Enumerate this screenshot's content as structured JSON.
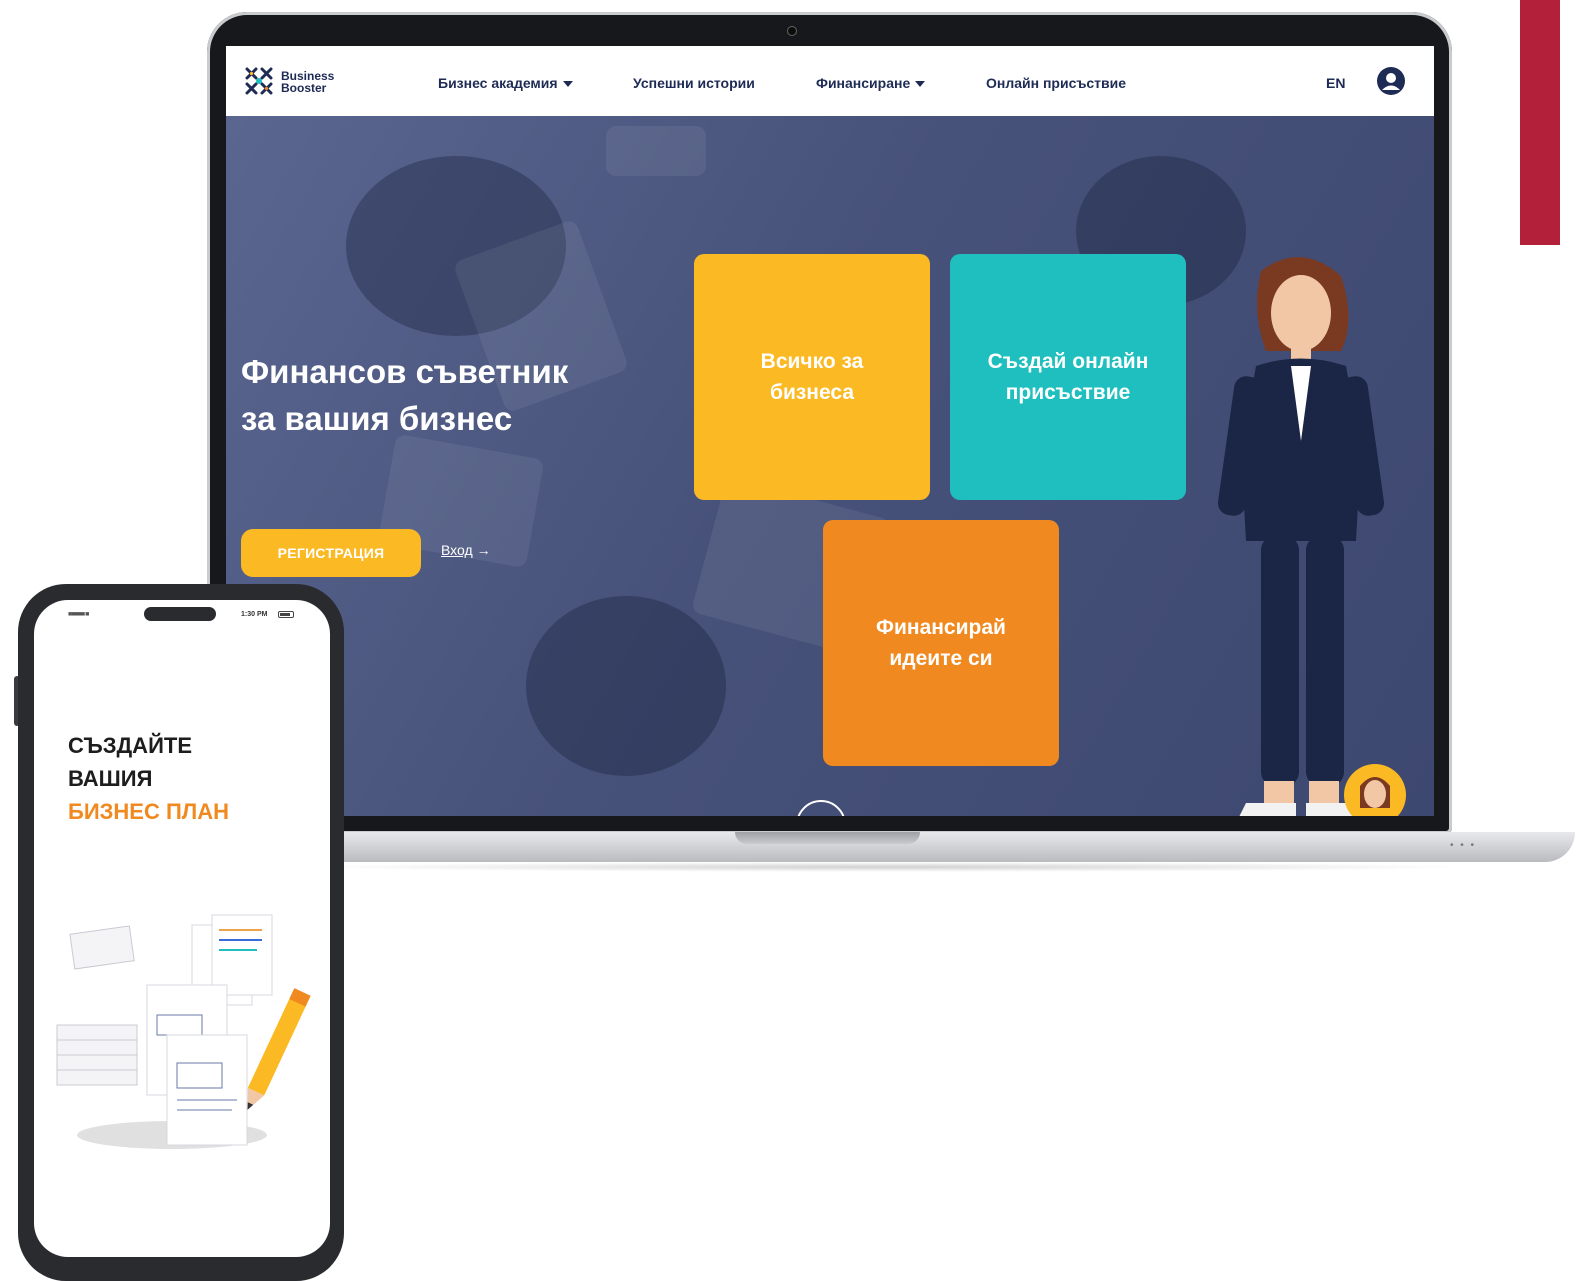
{
  "nav": {
    "logo_line1": "Business",
    "logo_line2": "Booster",
    "items": [
      {
        "label": "Бизнес академия",
        "dropdown": true
      },
      {
        "label": "Успешни истории",
        "dropdown": false
      },
      {
        "label": "Финансиране",
        "dropdown": true
      },
      {
        "label": "Онлайн присъствие",
        "dropdown": false
      }
    ],
    "lang": "EN",
    "user_icon": "user-avatar-icon"
  },
  "hero": {
    "title_line1": "Финансов съветник",
    "title_line2": "за вашия бизнес",
    "register_label": "РЕГИСТРАЦИЯ",
    "login_label": "Вход",
    "login_arrow": "→",
    "scroll_icon": "arrow-down-icon"
  },
  "tiles": {
    "yellow_line1": "Всичко за",
    "yellow_line2": "бизнеса",
    "teal_line1": "Създай онлайн",
    "teal_line2": "присъствие",
    "orange_line1": "Финансирай",
    "orange_line2": "идеите си"
  },
  "phone": {
    "status_time": "1:30 PM",
    "title_line1": "СЪЗДАЙТЕ",
    "title_line2": "ВАШИЯ",
    "title_line3": "БИЗНЕС ПЛАН"
  },
  "colors": {
    "brand_navy": "#1e2b55",
    "yellow": "#fbb924",
    "teal": "#1fbfbf",
    "orange": "#f08a20",
    "accent_red": "#b3203a"
  }
}
